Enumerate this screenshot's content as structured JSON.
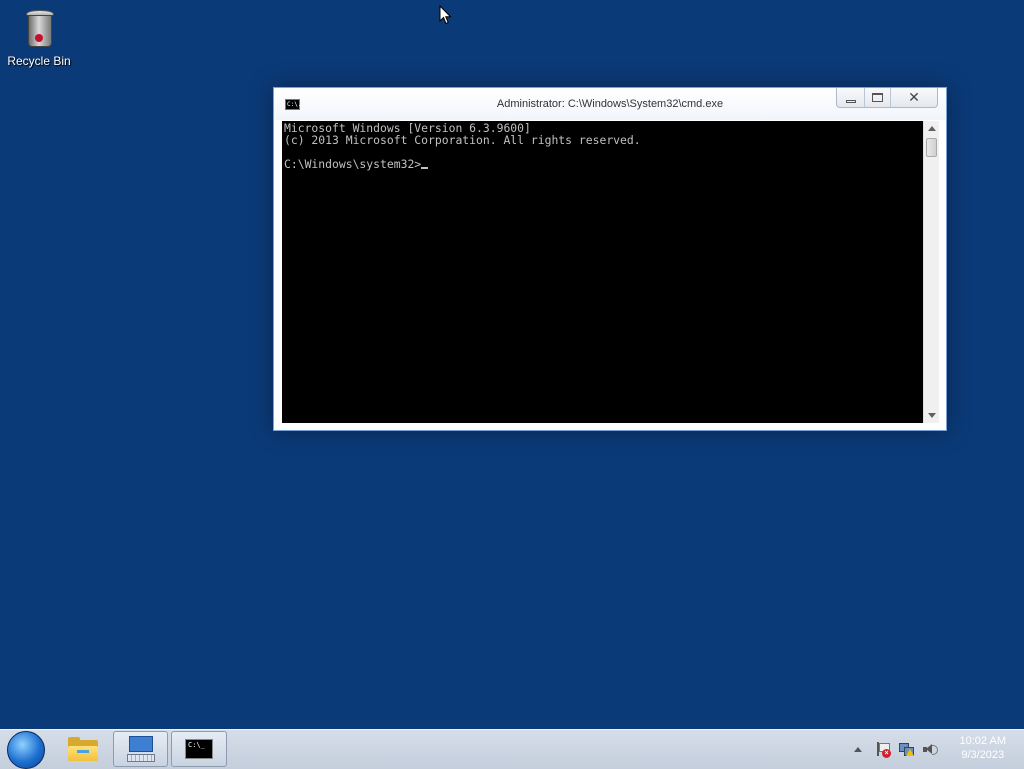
{
  "desktop": {
    "icons": [
      {
        "label": "Recycle Bin",
        "icon": "recycle-bin-icon"
      }
    ]
  },
  "window": {
    "title": "Administrator: C:\\Windows\\System32\\cmd.exe",
    "icon": "cmd-icon",
    "icon_text": "C:\\.",
    "controls": {
      "minimize": "minimize-icon",
      "maximize": "maximize-icon",
      "close": "✕"
    },
    "console": {
      "lines": [
        "Microsoft Windows [Version 6.3.9600]",
        "(c) 2013 Microsoft Corporation. All rights reserved.",
        "",
        "C:\\Windows\\system32>"
      ],
      "text_color": "#c0c0c0",
      "background": "#000000"
    }
  },
  "taskbar": {
    "start": "start-orb-icon",
    "pinned": [
      {
        "name": "file-explorer",
        "icon": "folder-icon"
      },
      {
        "name": "on-screen-keyboard",
        "icon": "keyboard-icon"
      },
      {
        "name": "command-prompt",
        "icon": "cmd-icon",
        "text": "C:\\_"
      }
    ],
    "tray": {
      "icons": [
        "show-hidden-icons-chevron-icon",
        "action-center-flag-icon",
        "network-warning-icon",
        "speaker-icon"
      ],
      "time": "10:02 AM",
      "date": "9/3/2023"
    }
  }
}
